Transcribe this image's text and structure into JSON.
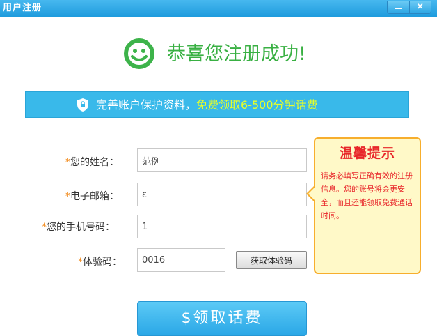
{
  "window": {
    "title": "用户注册",
    "close_glyph": "×"
  },
  "header": {
    "success_message": "恭喜您注册成功!",
    "smiley_color": "#3db34a"
  },
  "banner": {
    "text_main": "完善账户保护资料，",
    "text_highlight": "免费领取6-500分钟话费"
  },
  "form": {
    "name": {
      "required_mark": "*",
      "label": "您的姓名：",
      "value": "范例"
    },
    "email": {
      "required_mark": "*",
      "label": "电子邮箱：",
      "value": "ε"
    },
    "phone": {
      "required_mark": "*",
      "label": "您的手机号码：",
      "value": "1"
    },
    "captcha": {
      "required_mark": "*",
      "label": "体验码：",
      "value": "0016"
    },
    "get_captcha_label": "获取体验码"
  },
  "tip": {
    "title": "温馨提示",
    "body": "请务必填写正确有效的注册信息。您的账号将会更安全，而且还能领取免费通话时间。"
  },
  "actions": {
    "claim_label": "$领取话费"
  },
  "colors": {
    "accent_blue": "#39b9ea",
    "success_green": "#39b043",
    "highlight_yellow": "#e8ff28",
    "tip_red": "#e8262a",
    "tip_border": "#f7ae2d",
    "required_orange": "#f28a1b"
  }
}
